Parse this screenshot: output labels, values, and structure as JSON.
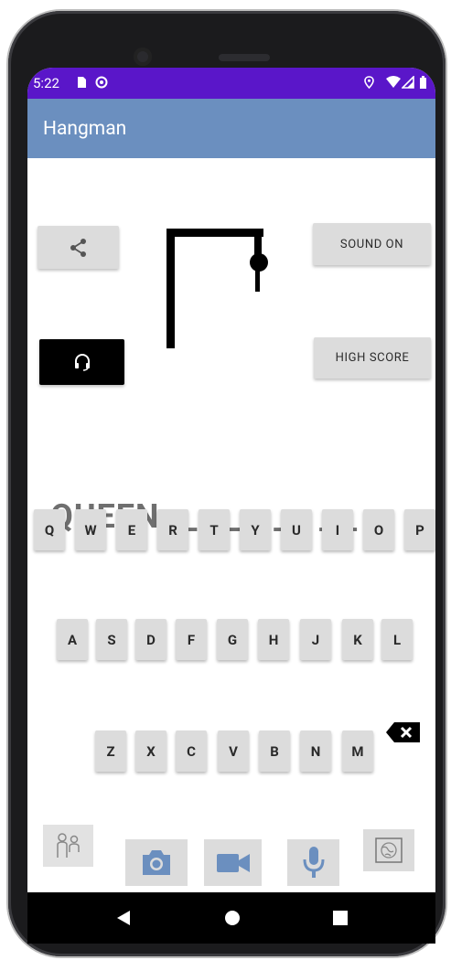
{
  "status_bar": {
    "time": "5:22"
  },
  "app_bar": {
    "title": "Hangman"
  },
  "buttons": {
    "sound": "SOUND ON",
    "high_score": "HIGH SCORE"
  },
  "game": {
    "revealed": "QUEEN",
    "blanks": "_ _ _ _ _ _ _ _ _ _"
  },
  "keyboard": {
    "row1": [
      "Q",
      "W",
      "E",
      "R",
      "T",
      "Y",
      "U",
      "I",
      "O",
      "P"
    ],
    "row2": [
      "A",
      "S",
      "D",
      "F",
      "G",
      "H",
      "J",
      "K",
      "L"
    ],
    "row3": [
      "Z",
      "X",
      "C",
      "V",
      "B",
      "N",
      "M"
    ]
  },
  "icons": {
    "share": "share-icon",
    "headset": "headset-icon",
    "backspace": "backspace-icon",
    "family": "family-icon",
    "camera": "camera-icon",
    "video": "video-icon",
    "mic": "microphone-icon",
    "map": "map-icon"
  },
  "colors": {
    "status_bar": "#5a16c9",
    "app_bar": "#6b8fbf",
    "button_bg": "#dcdcdc",
    "media_icon": "#6b8fbf"
  }
}
